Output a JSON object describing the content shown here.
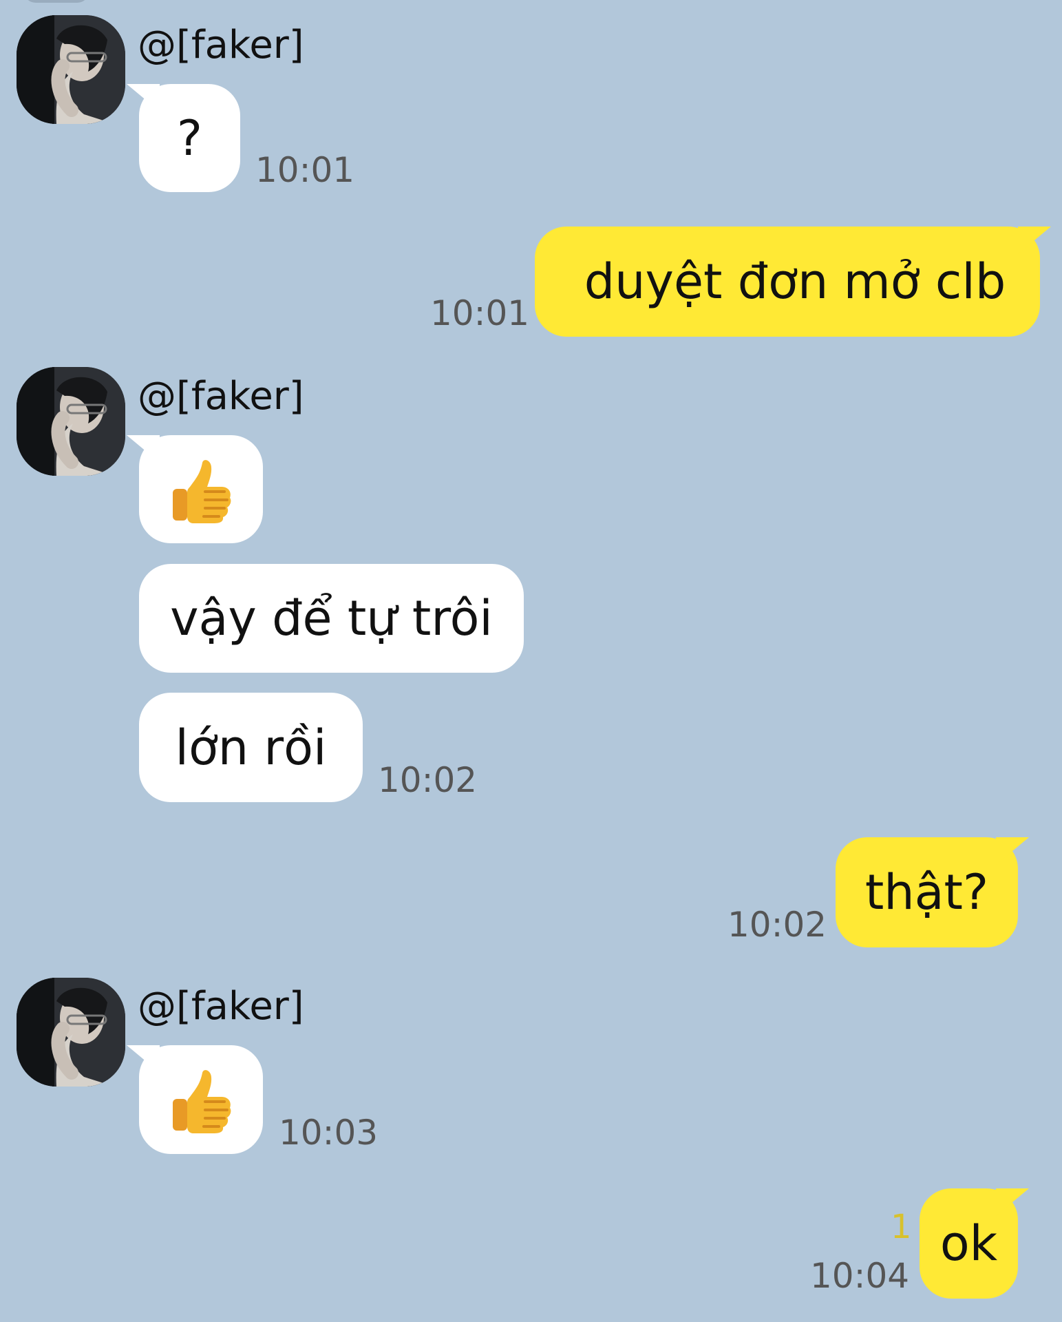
{
  "chat": {
    "sender": "@[faker]",
    "messages": [
      {
        "direction": "incoming",
        "text": "?",
        "time": "10:01"
      },
      {
        "direction": "outgoing",
        "text": "duyệt đơn mở clb",
        "time": "10:01"
      },
      {
        "direction": "incoming",
        "icon": "thumbs-up-icon"
      },
      {
        "direction": "incoming",
        "text": "vậy để tự trôi"
      },
      {
        "direction": "incoming",
        "text": "lớn rồi",
        "time": "10:02"
      },
      {
        "direction": "outgoing",
        "text": "thật?",
        "time": "10:02"
      },
      {
        "direction": "incoming",
        "icon": "thumbs-up-icon",
        "time": "10:03"
      },
      {
        "direction": "outgoing",
        "text": "ok",
        "time": "10:04",
        "unread_count": "1"
      }
    ]
  },
  "colors": {
    "background": "#b2c7da",
    "incoming_bubble": "#ffffff",
    "outgoing_bubble": "#ffe935",
    "time_text": "#555555",
    "unread_count": "#d8c12c"
  }
}
